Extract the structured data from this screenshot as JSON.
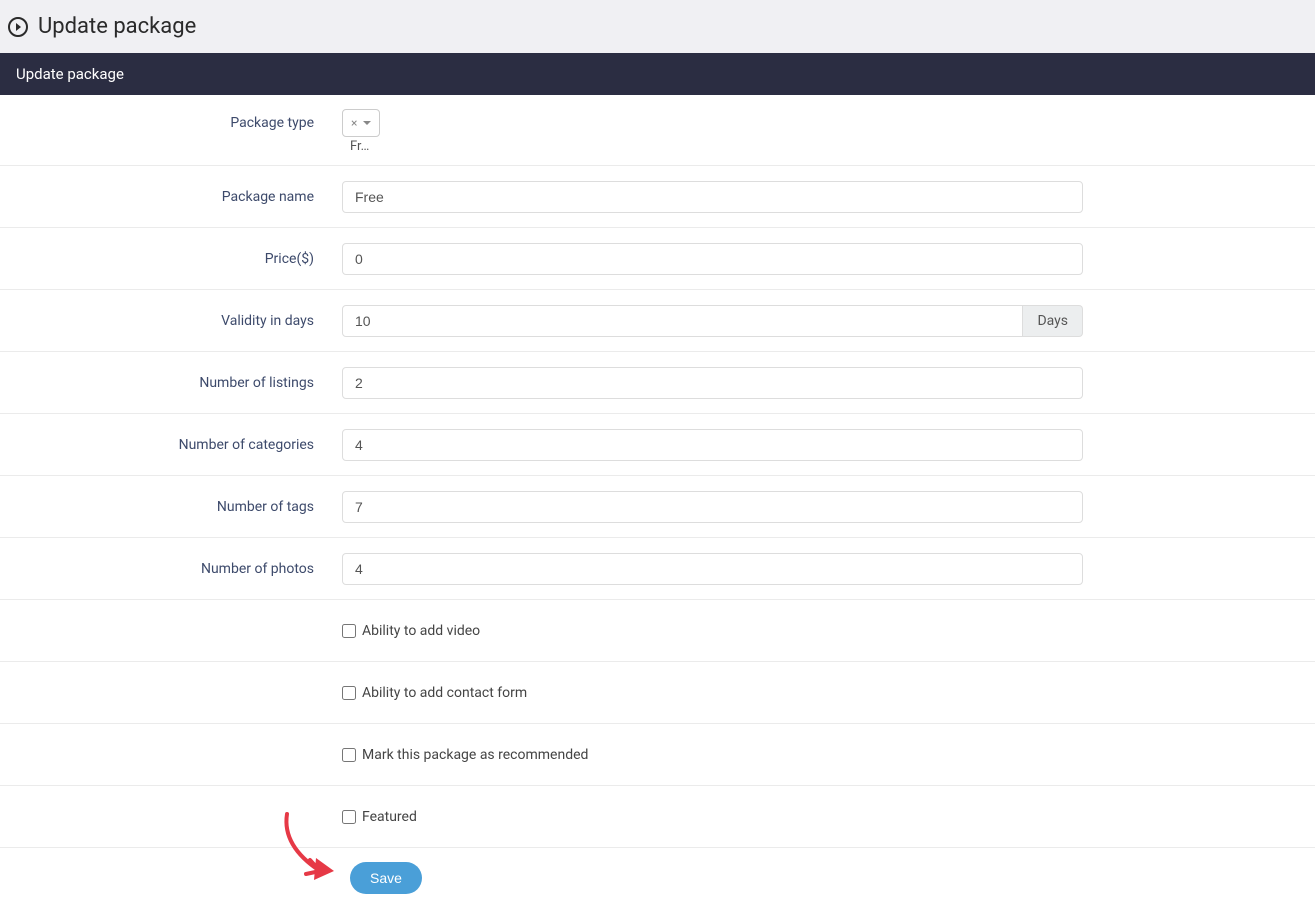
{
  "page": {
    "title": "Update package"
  },
  "panel": {
    "header": "Update package"
  },
  "form": {
    "package_type": {
      "label": "Package type",
      "selected_short": "Fr…"
    },
    "package_name": {
      "label": "Package name",
      "value": "Free"
    },
    "price": {
      "label": "Price($)",
      "value": "0"
    },
    "validity": {
      "label": "Validity in days",
      "value": "10",
      "addon": "Days"
    },
    "listings": {
      "label": "Number of listings",
      "value": "2"
    },
    "categories": {
      "label": "Number of categories",
      "value": "4"
    },
    "tags": {
      "label": "Number of tags",
      "value": "7"
    },
    "photos": {
      "label": "Number of photos",
      "value": "4"
    },
    "video": {
      "label": "Ability to add video",
      "checked": false
    },
    "contact_form": {
      "label": "Ability to add contact form",
      "checked": false
    },
    "recommended": {
      "label": "Mark this package as recommended",
      "checked": false
    },
    "featured": {
      "label": "Featured",
      "checked": false
    },
    "save_label": "Save"
  }
}
